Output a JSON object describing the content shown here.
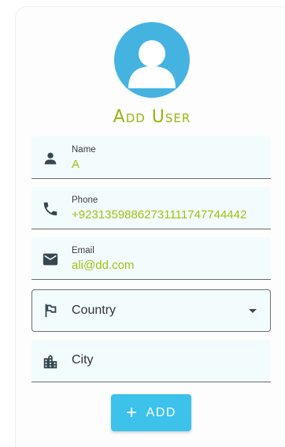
{
  "title": "Add User",
  "colors": {
    "accent": "#9bb312",
    "value_text": "#9bc40f",
    "avatar_bg": "#45b3e0",
    "button_bg": "#3dc2ec",
    "field_bg": "#f2fcfd"
  },
  "form": {
    "name": {
      "label": "Name",
      "value": "A",
      "icon": "person-icon"
    },
    "phone": {
      "label": "Phone",
      "value": "+92313598862731111747744442",
      "icon": "phone-icon"
    },
    "email": {
      "label": "Email",
      "value": "ali@dd.com",
      "icon": "email-icon"
    },
    "country": {
      "placeholder": "Country",
      "icon": "flag-icon"
    },
    "city": {
      "placeholder": "City",
      "icon": "city-icon"
    }
  },
  "add_button": {
    "label": "ADD",
    "icon": "plus-icon"
  }
}
